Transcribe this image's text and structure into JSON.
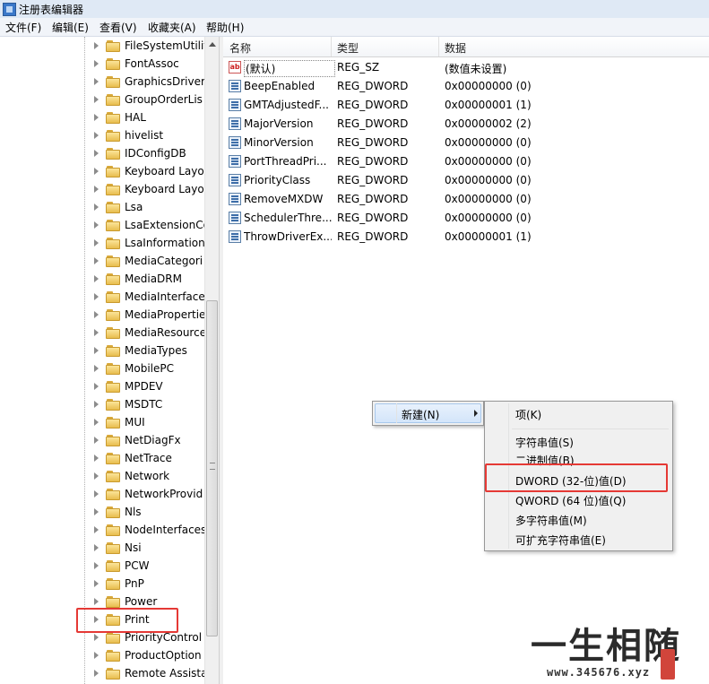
{
  "window": {
    "title": "注册表编辑器"
  },
  "menubar": {
    "items": [
      "文件(F)",
      "编辑(E)",
      "查看(V)",
      "收藏夹(A)",
      "帮助(H)"
    ]
  },
  "tree": {
    "items": [
      "FileSystemUtilit",
      "FontAssoc",
      "GraphicsDriver",
      "GroupOrderLis",
      "HAL",
      "hivelist",
      "IDConfigDB",
      "Keyboard Layo",
      "Keyboard Layo",
      "Lsa",
      "LsaExtensionCo",
      "LsaInformation",
      "MediaCategori",
      "MediaDRM",
      "MediaInterface",
      "MediaPropertie",
      "MediaResource",
      "MediaTypes",
      "MobilePC",
      "MPDEV",
      "MSDTC",
      "MUI",
      "NetDiagFx",
      "NetTrace",
      "Network",
      "NetworkProvid",
      "Nls",
      "NodeInterfaces",
      "Nsi",
      "PCW",
      "PnP",
      "Power",
      "Print",
      "PriorityControl",
      "ProductOption",
      "Remote Assista"
    ],
    "selected": "Print"
  },
  "list": {
    "headers": {
      "name": "名称",
      "type": "类型",
      "data": "数据"
    },
    "rows": [
      {
        "name": "(默认)",
        "type": "REG_SZ",
        "data": "(数值未设置)",
        "icon": "string-value-icon"
      },
      {
        "name": "BeepEnabled",
        "type": "REG_DWORD",
        "data": "0x00000000 (0)",
        "icon": "binary-value-icon"
      },
      {
        "name": "GMTAdjustedF...",
        "type": "REG_DWORD",
        "data": "0x00000001 (1)",
        "icon": "binary-value-icon"
      },
      {
        "name": "MajorVersion",
        "type": "REG_DWORD",
        "data": "0x00000002 (2)",
        "icon": "binary-value-icon"
      },
      {
        "name": "MinorVersion",
        "type": "REG_DWORD",
        "data": "0x00000000 (0)",
        "icon": "binary-value-icon"
      },
      {
        "name": "PortThreadPri...",
        "type": "REG_DWORD",
        "data": "0x00000000 (0)",
        "icon": "binary-value-icon"
      },
      {
        "name": "PriorityClass",
        "type": "REG_DWORD",
        "data": "0x00000000 (0)",
        "icon": "binary-value-icon"
      },
      {
        "name": "RemoveMXDW",
        "type": "REG_DWORD",
        "data": "0x00000000 (0)",
        "icon": "binary-value-icon"
      },
      {
        "name": "SchedulerThre...",
        "type": "REG_DWORD",
        "data": "0x00000000 (0)",
        "icon": "binary-value-icon"
      },
      {
        "name": "ThrowDriverEx...",
        "type": "REG_DWORD",
        "data": "0x00000001 (1)",
        "icon": "binary-value-icon"
      }
    ]
  },
  "context_menu": {
    "main_item": "新建(N)",
    "submenu": [
      "项(K)",
      "字符串值(S)",
      "二进制值(B)",
      "DWORD (32-位)值(D)",
      "QWORD (64 位)值(Q)",
      "多字符串值(M)",
      "可扩充字符串值(E)"
    ]
  },
  "watermark": {
    "text": "一生相随",
    "url": "www.345676.xyz"
  },
  "colors": {
    "highlight_box": "#e53935",
    "menu_bg": "#f0f0f0",
    "folder": "#f3cf6b"
  }
}
